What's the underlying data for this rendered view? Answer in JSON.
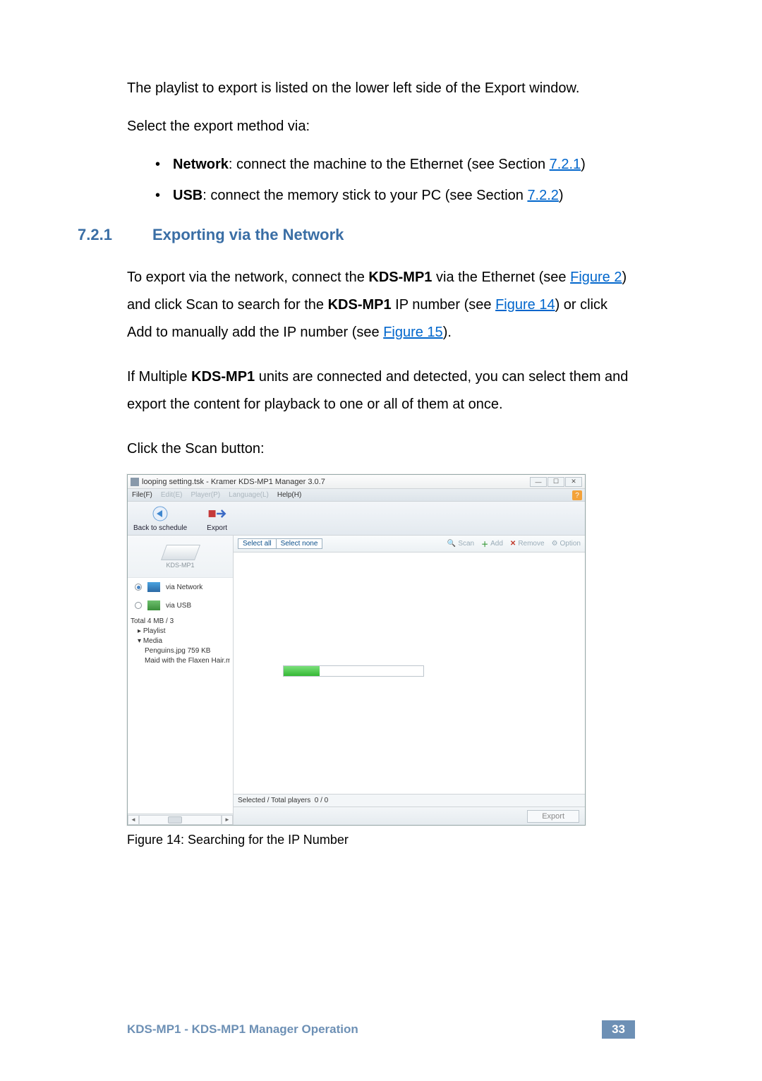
{
  "intro_p1": "The playlist to export is listed on the lower left side of the Export window.",
  "intro_p2": "Select the export method via:",
  "bullet1_label": "Network",
  "bullet1_text": ": connect the machine to the Ethernet (see Section ",
  "bullet1_link": "7.2.1",
  "bullet1_close": ")",
  "bullet2_label": "USB",
  "bullet2_text": ": connect the memory stick to your PC (see Section ",
  "bullet2_link": "7.2.2",
  "bullet2_close": ")",
  "section_num": "7.2.1",
  "section_title": "Exporting via the Network",
  "para1_a": "To export via the network, connect the ",
  "para1_b": "KDS-MP1",
  "para1_c": " via the Ethernet (see ",
  "para1_link1": "Figure 2",
  "para1_d": ") and click Scan to search for the ",
  "para1_e": "KDS-MP1",
  "para1_f": " IP number (see ",
  "para1_link2": "Figure 14",
  "para1_g": ") or click Add to manually add the IP number (see ",
  "para1_link3": "Figure 15",
  "para1_h": ").",
  "para2_a": "If Multiple ",
  "para2_b": "KDS-MP1",
  "para2_c": " units are connected and detected, you can select them and export the content for playback to one or all of them at once.",
  "para3": "Click the Scan button:",
  "win_title": "looping setting.tsk - Kramer KDS-MP1 Manager 3.0.7",
  "menu": {
    "file": "File(F)",
    "edit": "Edit(E)",
    "player": "Player(P)",
    "language": "Language(L)",
    "help": "Help(H)"
  },
  "tool_back": "Back to schedule",
  "tool_export": "Export",
  "device_label": "KDS-MP1",
  "radio_net": "via Network",
  "radio_usb": "via USB",
  "total_line": "Total 4 MB / 3",
  "tree": {
    "playlist": "Playlist",
    "media": "Media",
    "item1": "Penguins.jpg 759 KB",
    "item2": "Maid with the Flaxen Hair.mp."
  },
  "sel_all": "Select all",
  "sel_none": "Select none",
  "btn_scan": "Scan",
  "btn_add": "Add",
  "btn_remove": "Remove",
  "btn_option": "Option",
  "status_label": "Selected / Total players",
  "status_value": "0 / 0",
  "export_btn": "Export",
  "caption": "Figure 14: Searching for the IP Number",
  "footer": "KDS-MP1 - KDS-MP1 Manager Operation",
  "page_num": "33"
}
